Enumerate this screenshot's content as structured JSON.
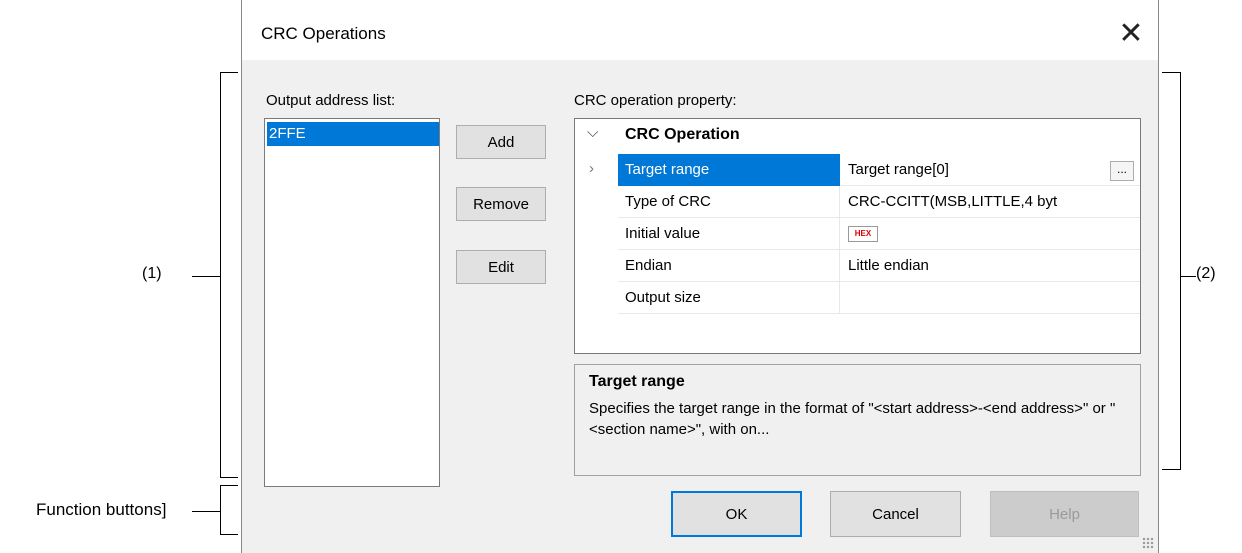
{
  "dialog": {
    "title": "CRC Operations",
    "close_icon": "close-icon"
  },
  "output_address": {
    "label": "Output address list:",
    "items": [
      "2FFE"
    ]
  },
  "side_buttons": {
    "add": "Add",
    "remove": "Remove",
    "edit": "Edit"
  },
  "property": {
    "label": "CRC operation property:",
    "category": "CRC Operation",
    "rows": [
      {
        "name": "Target range",
        "value": "Target range[0]"
      },
      {
        "name": "Type of CRC",
        "value": "CRC-CCITT(MSB,LITTLE,4 byt"
      },
      {
        "name": "Initial value",
        "value": "HEX"
      },
      {
        "name": "Endian",
        "value": "Little endian"
      },
      {
        "name": "Output size",
        "value": ""
      }
    ],
    "ellipsis": "..."
  },
  "description": {
    "title": "Target range",
    "text": "Specifies the target range in the format of \"<start address>-<end address>\" or \"<section name>\", with on..."
  },
  "footer_buttons": {
    "ok": "OK",
    "cancel": "Cancel",
    "help": "Help"
  },
  "annotations": {
    "left": "(1)",
    "right": "(2)",
    "function": "Function buttons]"
  },
  "colors": {
    "selection": "#0078d7",
    "dialog_bg": "#f0f0f0"
  }
}
